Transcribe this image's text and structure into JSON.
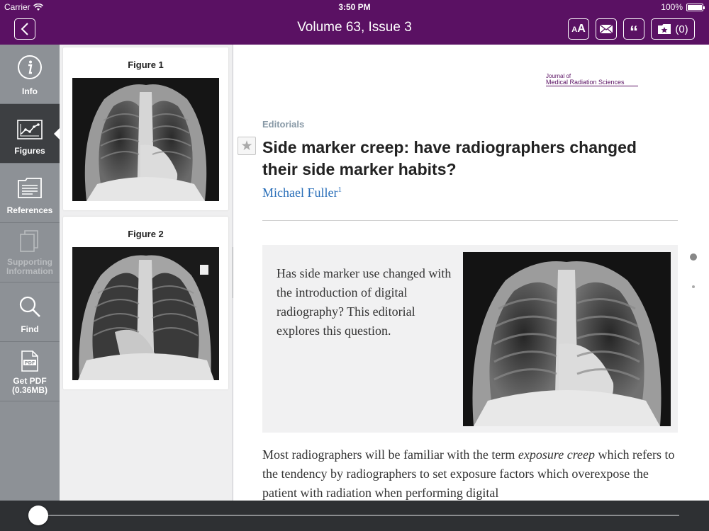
{
  "status": {
    "carrier": "Carrier",
    "time": "3:50 PM",
    "battery": "100%"
  },
  "nav": {
    "title": "Volume 63, Issue 3",
    "text_size_label": "AA",
    "cite_label": "“",
    "collections_count": "(0)"
  },
  "tools": [
    {
      "label": "Info",
      "icon": "info-icon"
    },
    {
      "label": "Figures",
      "icon": "chart-icon"
    },
    {
      "label": "References",
      "icon": "folder-icon"
    },
    {
      "label": "Supporting Information",
      "icon": "documents-icon"
    },
    {
      "label": "Find",
      "icon": "search-icon"
    },
    {
      "label": "Get PDF (0.36MB)",
      "icon": "pdf-icon"
    }
  ],
  "figures": [
    {
      "label": "Figure 1"
    },
    {
      "label": "Figure 2"
    }
  ],
  "article": {
    "journal_small": "Journal of",
    "journal_name": "Medical Radiation Sciences",
    "section": "Editorials",
    "title": "Side marker creep: have radiographers changed their side marker habits?",
    "author": "Michael Fuller",
    "author_sup": "1",
    "abstract": "Has side marker use changed with the introduction of digital radiography? This editorial explores this question.",
    "body_pre": "Most radiographers will be familiar with the term ",
    "body_em": "exposure creep",
    "body_post": " which refers to the tendency by radiographers to set exposure factors which overexpose the patient with radiation when performing digital"
  },
  "colors": {
    "brand": "#5a1163",
    "link": "#2a6fb9",
    "sidebar": "#8d9196"
  },
  "scrubber": {
    "position": 0.0
  }
}
